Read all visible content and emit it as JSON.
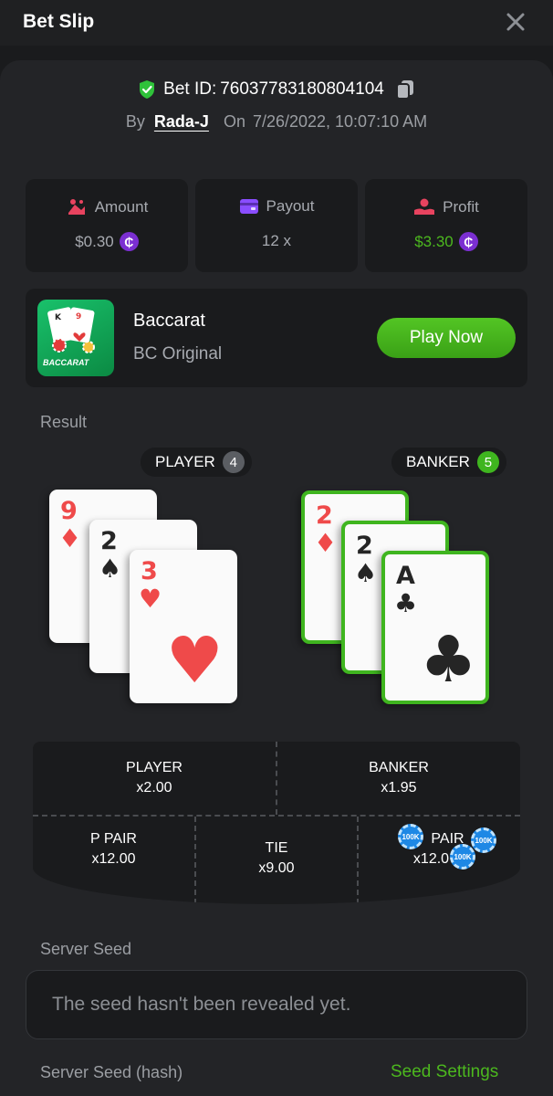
{
  "header": {
    "title": "Bet Slip"
  },
  "bet": {
    "id_label": "Bet ID:",
    "id_value": "76037783180804104",
    "by_label": "By",
    "user": "Rada-J",
    "on_label": "On",
    "datetime": "7/26/2022, 10:07:10 AM"
  },
  "stats": {
    "amount": {
      "label": "Amount",
      "value": "$0.30"
    },
    "payout": {
      "label": "Payout",
      "value": "12 x"
    },
    "profit": {
      "label": "Profit",
      "value": "$3.30"
    }
  },
  "game": {
    "name": "Baccarat",
    "provider": "BC Original",
    "thumb_label": "BACCARAT",
    "play_label": "Play Now"
  },
  "result": {
    "label": "Result",
    "player": {
      "label": "PLAYER",
      "score": "4",
      "cards": [
        {
          "rank": "9",
          "suit": "♦",
          "color": "red"
        },
        {
          "rank": "2",
          "suit": "♠",
          "color": "black"
        },
        {
          "rank": "3",
          "suit": "♥",
          "color": "red"
        }
      ]
    },
    "banker": {
      "label": "BANKER",
      "score": "5",
      "cards": [
        {
          "rank": "2",
          "suit": "♦",
          "color": "red"
        },
        {
          "rank": "2",
          "suit": "♠",
          "color": "black"
        },
        {
          "rank": "A",
          "suit": "♣",
          "color": "black"
        }
      ]
    }
  },
  "bet_table": {
    "player": {
      "label": "PLAYER",
      "odds": "x2.00"
    },
    "banker": {
      "label": "BANKER",
      "odds": "x1.95"
    },
    "p_pair": {
      "label": "P PAIR",
      "odds": "x12.00"
    },
    "tie": {
      "label": "TIE",
      "odds": "x9.00"
    },
    "b_pair": {
      "label": "PAIR",
      "odds": "x12.0"
    },
    "chip_label": "100K"
  },
  "seed": {
    "server_seed_label": "Server Seed",
    "server_seed_value": "The seed hasn't been revealed yet.",
    "hash_label": "Server Seed (hash)",
    "settings_link": "Seed Settings"
  },
  "colors": {
    "accent_green": "#4cb81e",
    "coin_purple": "#7b2fd1",
    "amount_red": "#e8435f",
    "payout_purple": "#8a4dff",
    "profit_red": "#e8435f",
    "background": "#1a1b1d",
    "panel": "#232427"
  },
  "icons": {
    "close": "close-icon",
    "verified": "shield-check-icon",
    "copy": "copy-icon",
    "amount": "bet-chips-icon",
    "payout": "wallet-icon",
    "profit": "hand-coins-icon",
    "currency": "bcd-coin-icon"
  }
}
